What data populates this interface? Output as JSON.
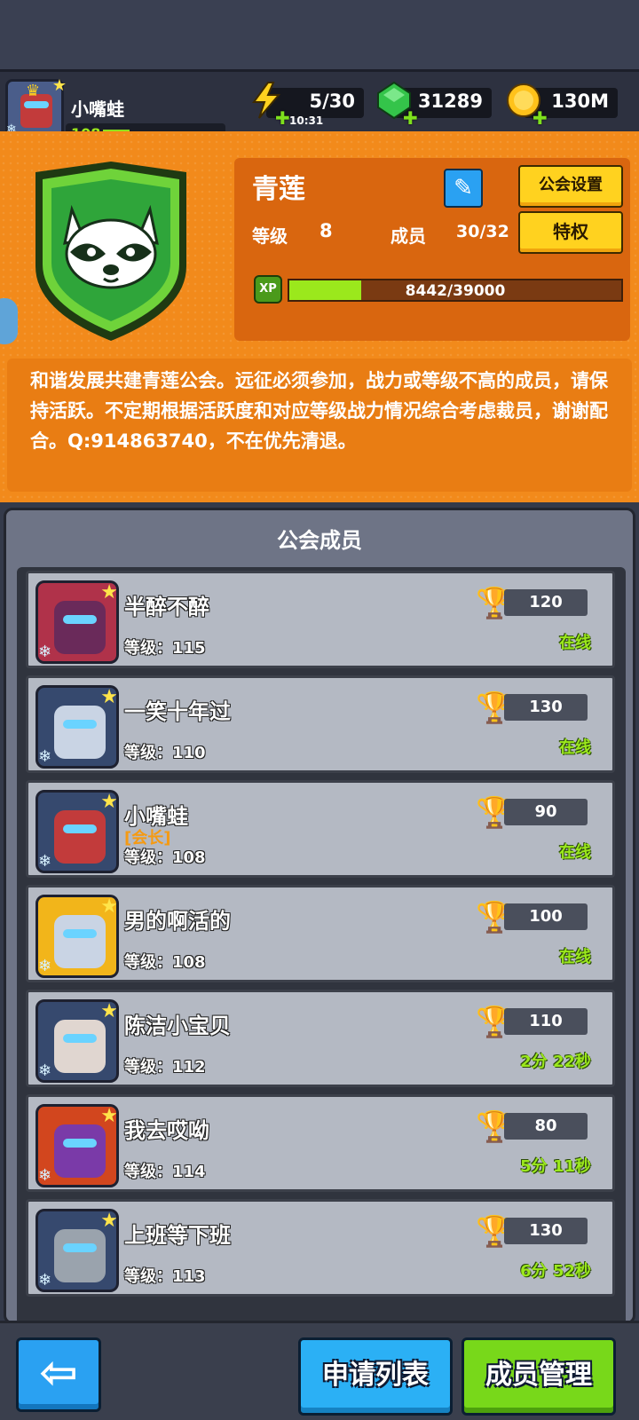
{
  "player": {
    "name": "小嘴蛙",
    "level": "108"
  },
  "resources": {
    "energy": "5/30",
    "energy_timer": "10:31",
    "gems": "31289",
    "gold": "130M"
  },
  "guild": {
    "name": "青莲",
    "settings_label": "公会设置",
    "privilege_label": "特权",
    "level_label": "等级",
    "level_value": "8",
    "members_label": "成员",
    "members_value": "30/32",
    "xp_badge": "XP",
    "xp_text": "8442/39000",
    "xp_fraction": 0.2165,
    "description": "和谐发展共建青莲公会。远征必须参加，战力或等级不高的成员，请保持活跃。不定期根据活跃度和对应等级战力情况综合考虑裁员，谢谢配合。Q:914863740，不在优先清退。"
  },
  "members_title": "公会成员",
  "members": [
    {
      "name": "半醉不醉",
      "role": "",
      "level": "等级：115",
      "score": "120",
      "status": "在线",
      "avatar_color": "#b0324a",
      "fig_color": "#6a2a5a"
    },
    {
      "name": "一笑十年过",
      "role": "",
      "level": "等级：110",
      "score": "130",
      "status": "在线",
      "avatar_color": "#36496e",
      "fig_color": "#c9d4e4"
    },
    {
      "name": "小嘴蛙",
      "role": "[会长]",
      "level": "等级：108",
      "score": "90",
      "status": "在线",
      "avatar_color": "#36496e",
      "fig_color": "#c23b3b"
    },
    {
      "name": "男的啊活的",
      "role": "",
      "level": "等级：108",
      "score": "100",
      "status": "在线",
      "avatar_color": "#f2b51a",
      "fig_color": "#c9d4e4"
    },
    {
      "name": "陈洁小宝贝",
      "role": "",
      "level": "等级：112",
      "score": "110",
      "status": "2分 22秒",
      "avatar_color": "#36496e",
      "fig_color": "#e0d6d0"
    },
    {
      "name": "我去哎呦",
      "role": "",
      "level": "等级：114",
      "score": "80",
      "status": "5分 11秒",
      "avatar_color": "#d2461e",
      "fig_color": "#7a3aa8"
    },
    {
      "name": "上班等下班",
      "role": "",
      "level": "等级：113",
      "score": "130",
      "status": "6分 52秒",
      "avatar_color": "#36496e",
      "fig_color": "#9aa3ad"
    }
  ],
  "bottom": {
    "back_label": "⇦",
    "apply_label": "申请列表",
    "manage_label": "成员管理"
  }
}
